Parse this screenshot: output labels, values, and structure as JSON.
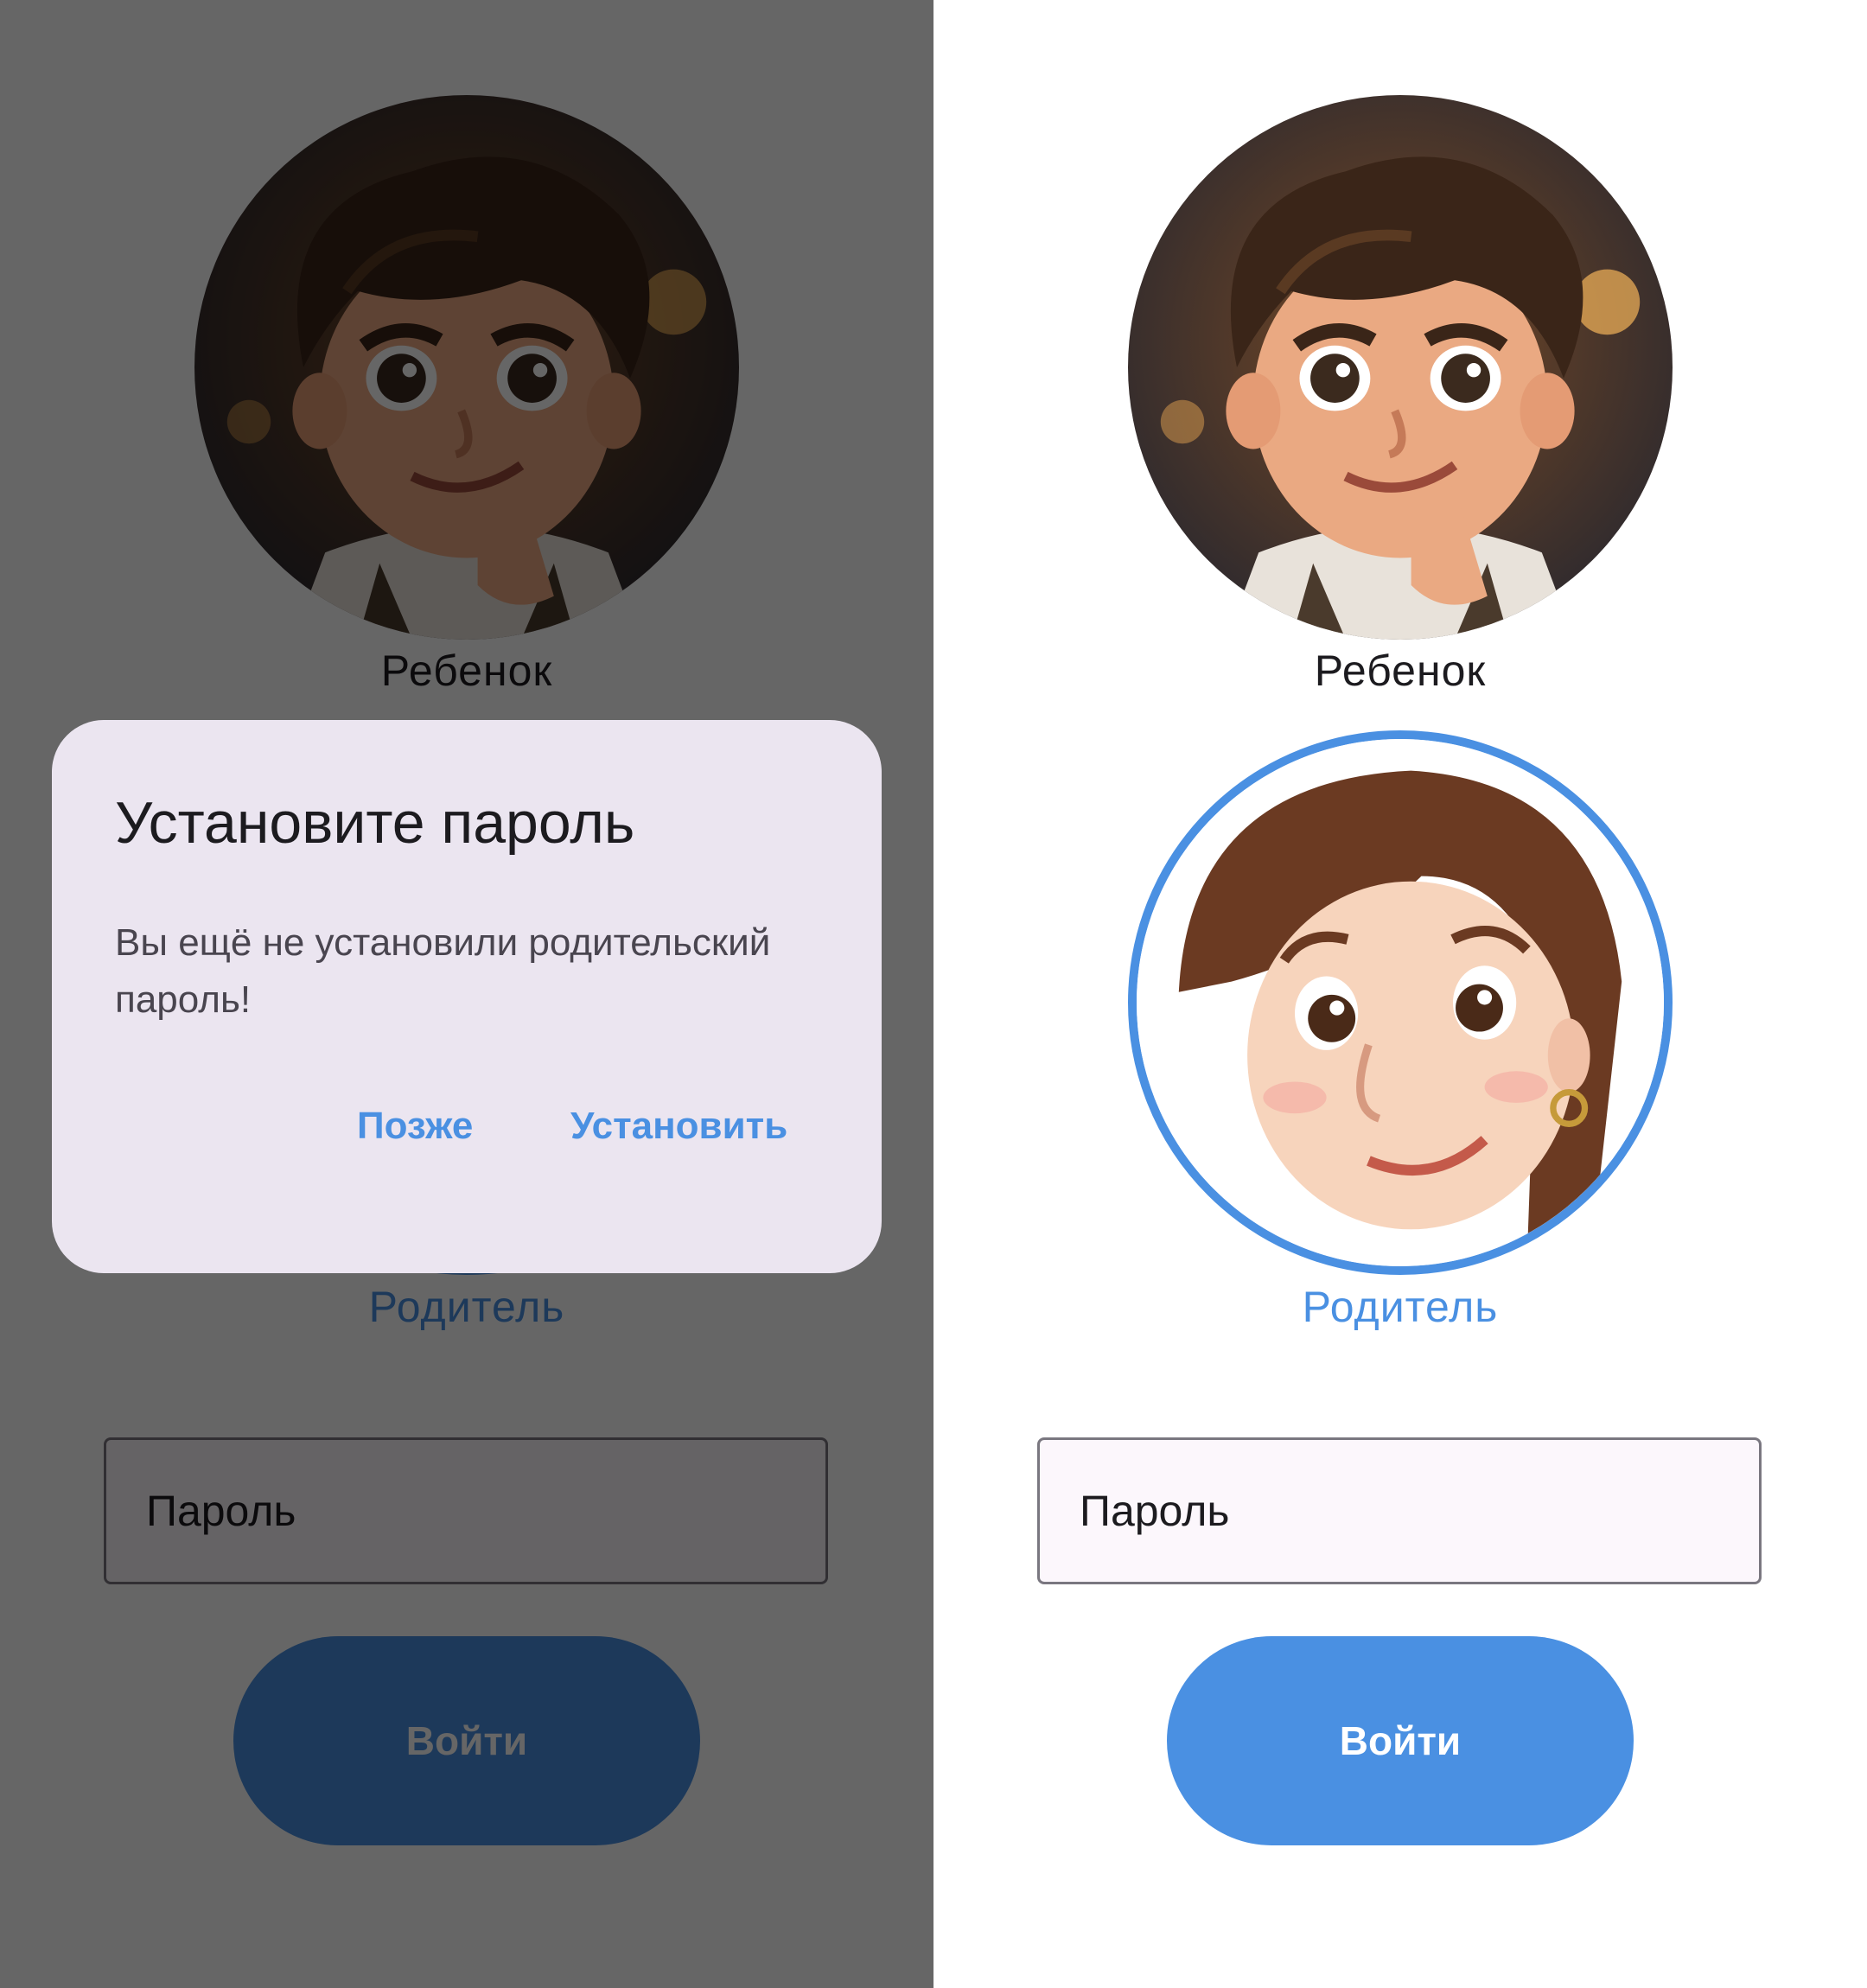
{
  "dialog": {
    "title": "Установите пароль",
    "message": "Вы ещё не установили родительский пароль!",
    "later_label": "Позже",
    "set_label": "Установить"
  },
  "profiles": {
    "child": {
      "name": "Ребенок",
      "avatar": "boy-cartoon-avatar"
    },
    "parent": {
      "name": "Родитель",
      "avatar": "woman-cartoon-avatar",
      "selected": true
    }
  },
  "password": {
    "placeholder": "Пароль"
  },
  "login": {
    "label": "Войти"
  },
  "colors": {
    "accent": "#4a90e2",
    "dialog_bg": "#ebe5f0",
    "field_bg": "#fcf7fc",
    "scrim": "rgba(0,0,0,0.6)"
  }
}
